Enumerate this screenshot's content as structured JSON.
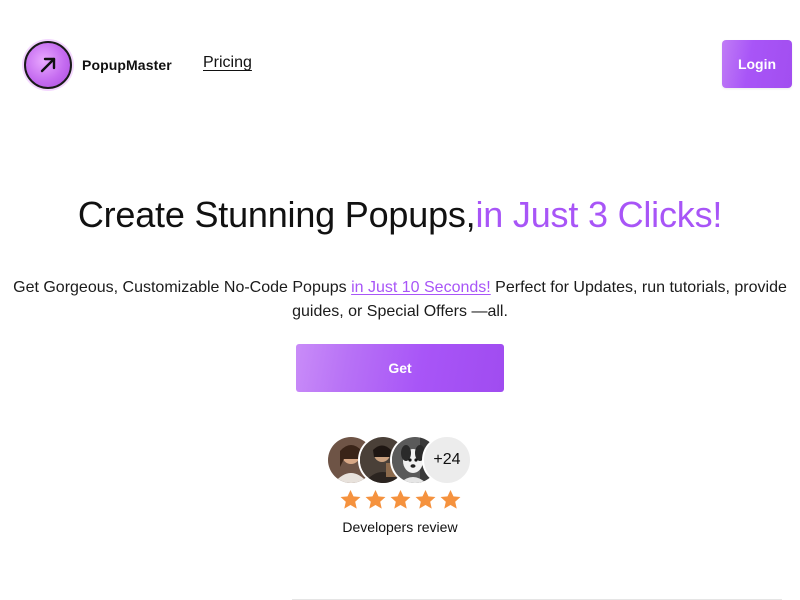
{
  "header": {
    "brand_name": "PopupMaster",
    "nav_pricing": "Pricing",
    "login_label": "Login"
  },
  "hero": {
    "title_main": "Create Stunning Popups,",
    "title_accent": "in Just 3 Clicks!",
    "subtitle_before": "Get Gorgeous, Customizable No-Code Popups ",
    "subtitle_link": "in Just 10 Seconds!",
    "subtitle_after": " Perfect for Updates, run tutorials, provide guides, or Special Offers —all.",
    "cta_label": "Get"
  },
  "social_proof": {
    "avatars": [
      "avatar-person",
      "avatar-person",
      "avatar-dog"
    ],
    "more_count": "+24",
    "rating": 5,
    "rating_max": 5,
    "review_label": "Developers review"
  },
  "colors": {
    "accent": "#a855f7",
    "star": "#f5923e",
    "text": "#111111"
  },
  "icons": {
    "logo": "arrow-up-right-icon",
    "star": "star-icon"
  }
}
